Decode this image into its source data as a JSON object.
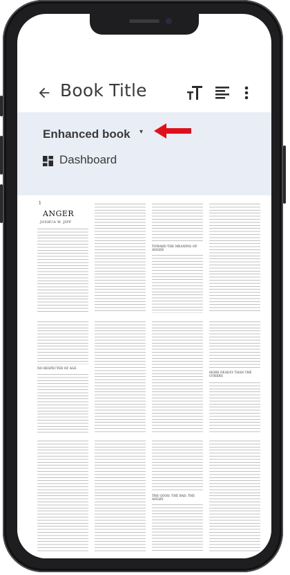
{
  "app_bar": {
    "title": "Book Title",
    "icons": {
      "back": "arrow-left-icon",
      "text_size": "text-size-icon",
      "align": "align-left-icon",
      "more": "more-vert-icon"
    }
  },
  "edition": {
    "label": "Enhanced book",
    "caret": "▾",
    "dashboard_label": "Dashboard",
    "annotation_color": "#e0101a"
  },
  "book": {
    "chapter_number": "1",
    "chapter_title": "ANGER",
    "author": "JOSHUA W. JIPP",
    "headings": [
      "TOWARD THE MEANING OF ANGER",
      "NO RESPECTER OF AGE",
      "MORE DEADLY THAN THE OTHERS",
      "THE GOOD, THE BAD, THE ANGRY"
    ]
  },
  "colors": {
    "panel_bg": "#e9edf5",
    "title_text": "#3b3b3b",
    "frame": "#1e1e20"
  }
}
